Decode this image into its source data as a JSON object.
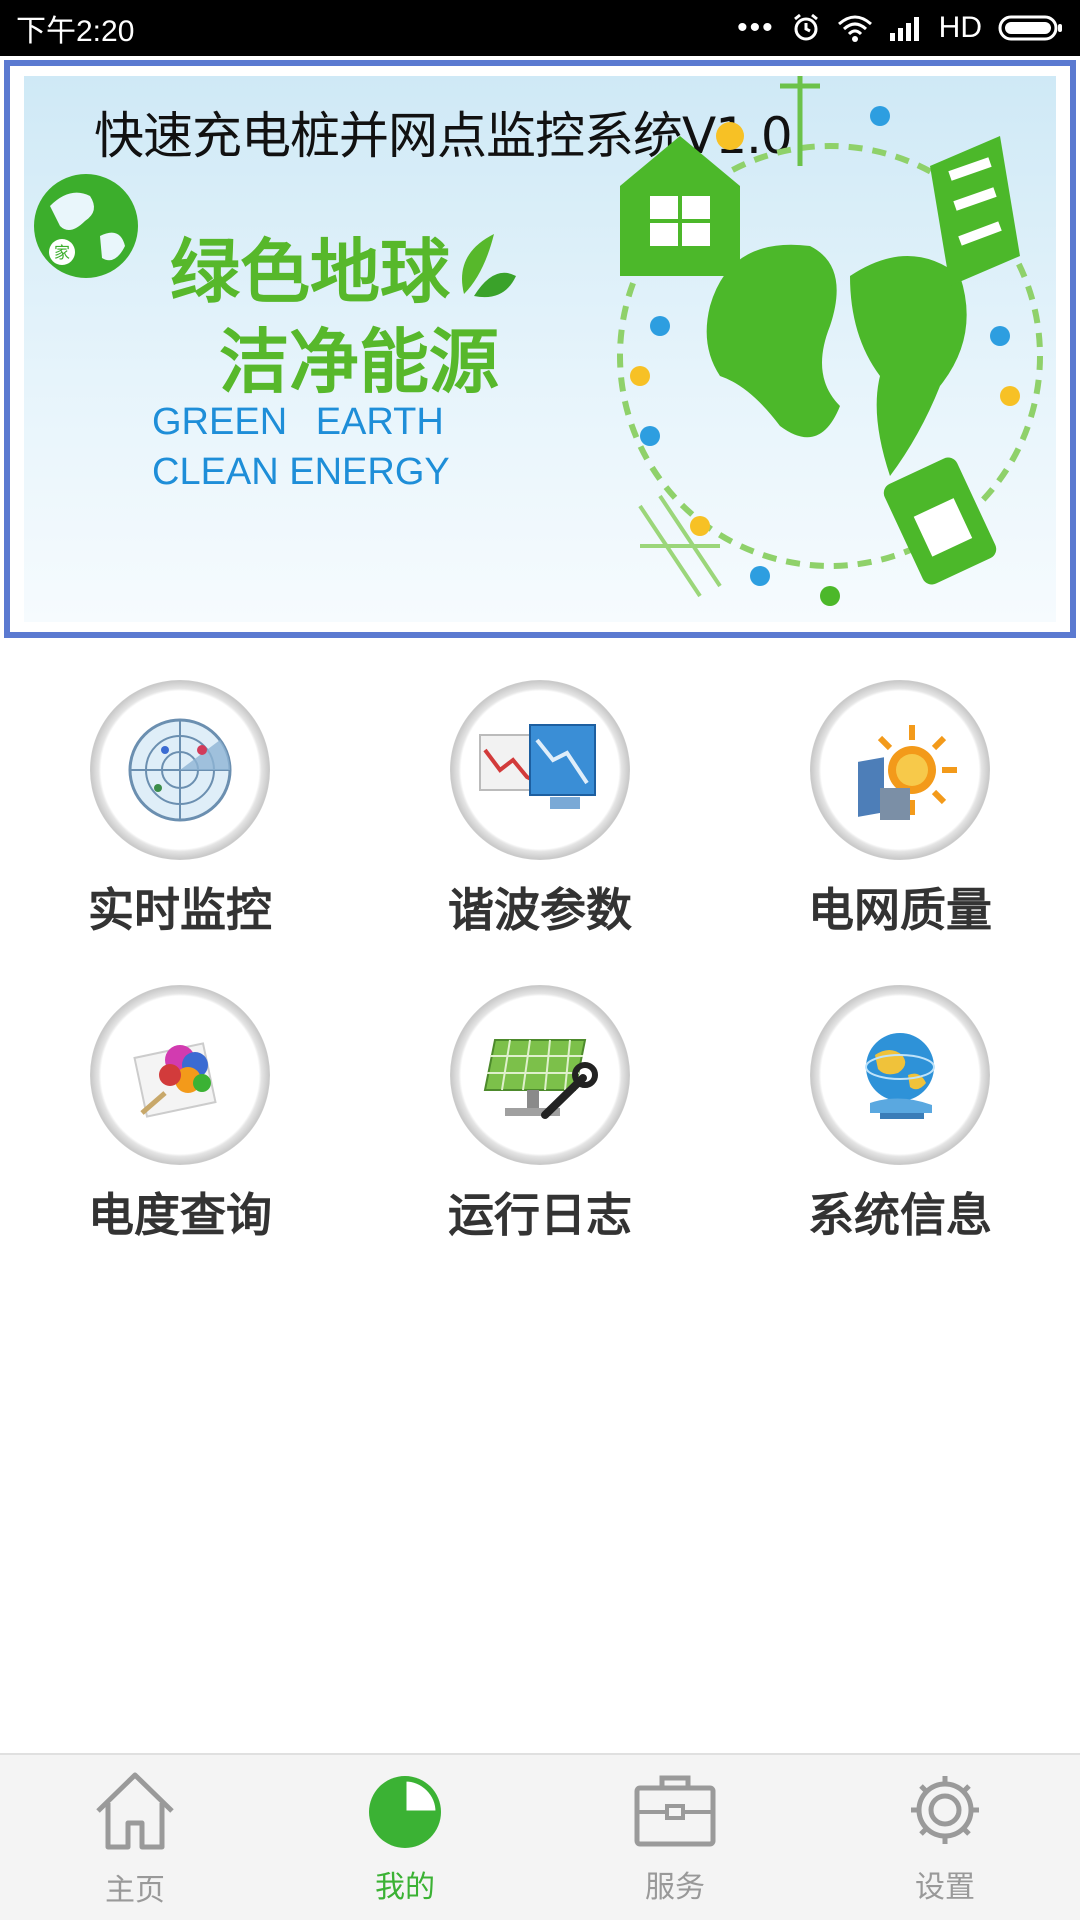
{
  "status_bar": {
    "time": "下午2:20",
    "dots": "•••",
    "network": "HD"
  },
  "banner": {
    "title": "快速充电桩并网点监控系统V1.0",
    "slogan_line1": "绿色地球",
    "slogan_line2": "洁净能源",
    "english_line1": "GREEN EARTH",
    "english_line2": "CLEAN ENERGY",
    "logo_text": "家"
  },
  "menu": [
    {
      "label": "实时监控",
      "icon": "radar-icon"
    },
    {
      "label": "谐波参数",
      "icon": "chart-trend-icon"
    },
    {
      "label": "电网质量",
      "icon": "sun-energy-icon"
    },
    {
      "label": "电度查询",
      "icon": "color-palette-icon"
    },
    {
      "label": "运行日志",
      "icon": "solar-panel-wrench-icon"
    },
    {
      "label": "系统信息",
      "icon": "globe-info-icon"
    }
  ],
  "bottom_nav": [
    {
      "label": "主页",
      "icon": "home-icon",
      "active": false
    },
    {
      "label": "我的",
      "icon": "pie-chart-icon",
      "active": true
    },
    {
      "label": "服务",
      "icon": "briefcase-icon",
      "active": false
    },
    {
      "label": "设置",
      "icon": "gear-icon",
      "active": false
    }
  ],
  "colors": {
    "accent_green": "#3bb234",
    "banner_border": "#5b7ad1",
    "slogan_green": "#57b82b",
    "english_blue": "#1e8ed8"
  }
}
